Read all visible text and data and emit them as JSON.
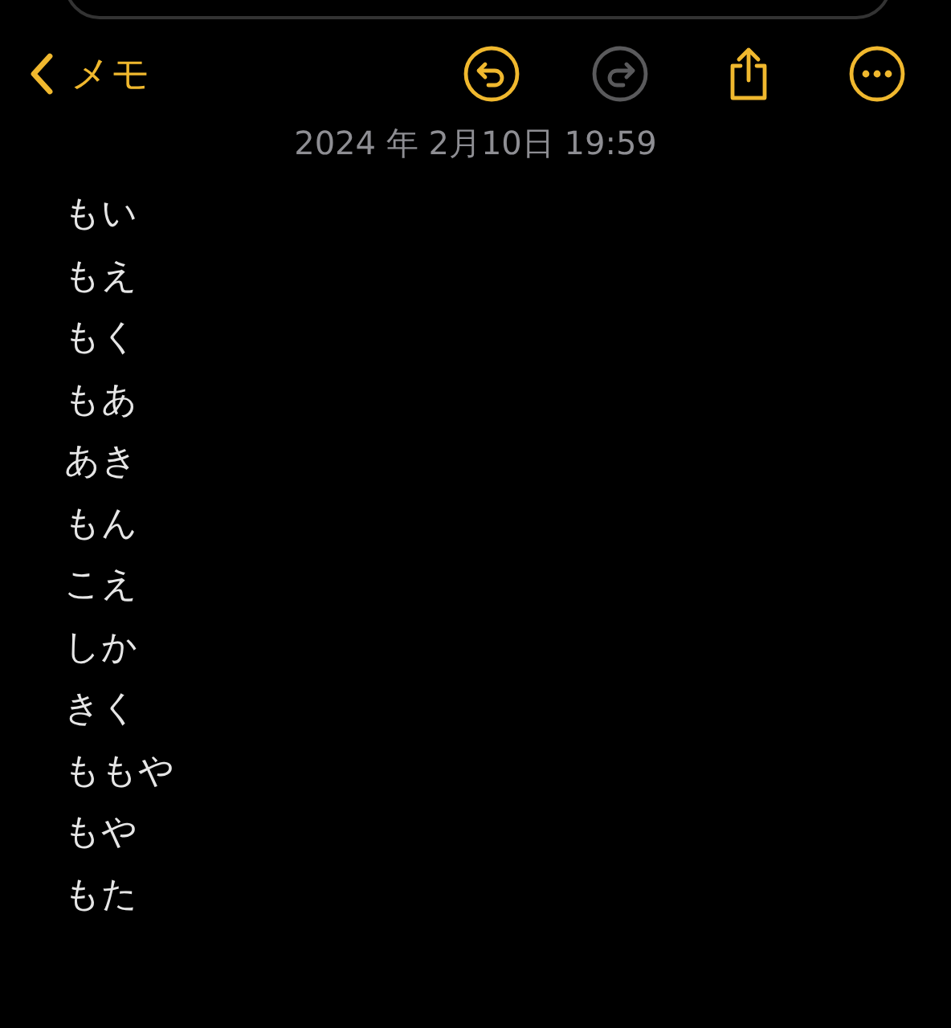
{
  "nav": {
    "back_label": "メモ"
  },
  "toolbar": [
    {
      "kind": "undo",
      "disabled": false
    },
    {
      "kind": "redo",
      "disabled": true
    },
    {
      "kind": "share",
      "disabled": false
    },
    {
      "kind": "more",
      "disabled": false
    }
  ],
  "date": "2024 年 2月10日 19:59",
  "lines": [
    "もい",
    "もえ",
    "もく",
    "もあ",
    "あき",
    "もん",
    "こえ",
    "しか",
    "きく",
    "ももや",
    "もや",
    "もた"
  ]
}
